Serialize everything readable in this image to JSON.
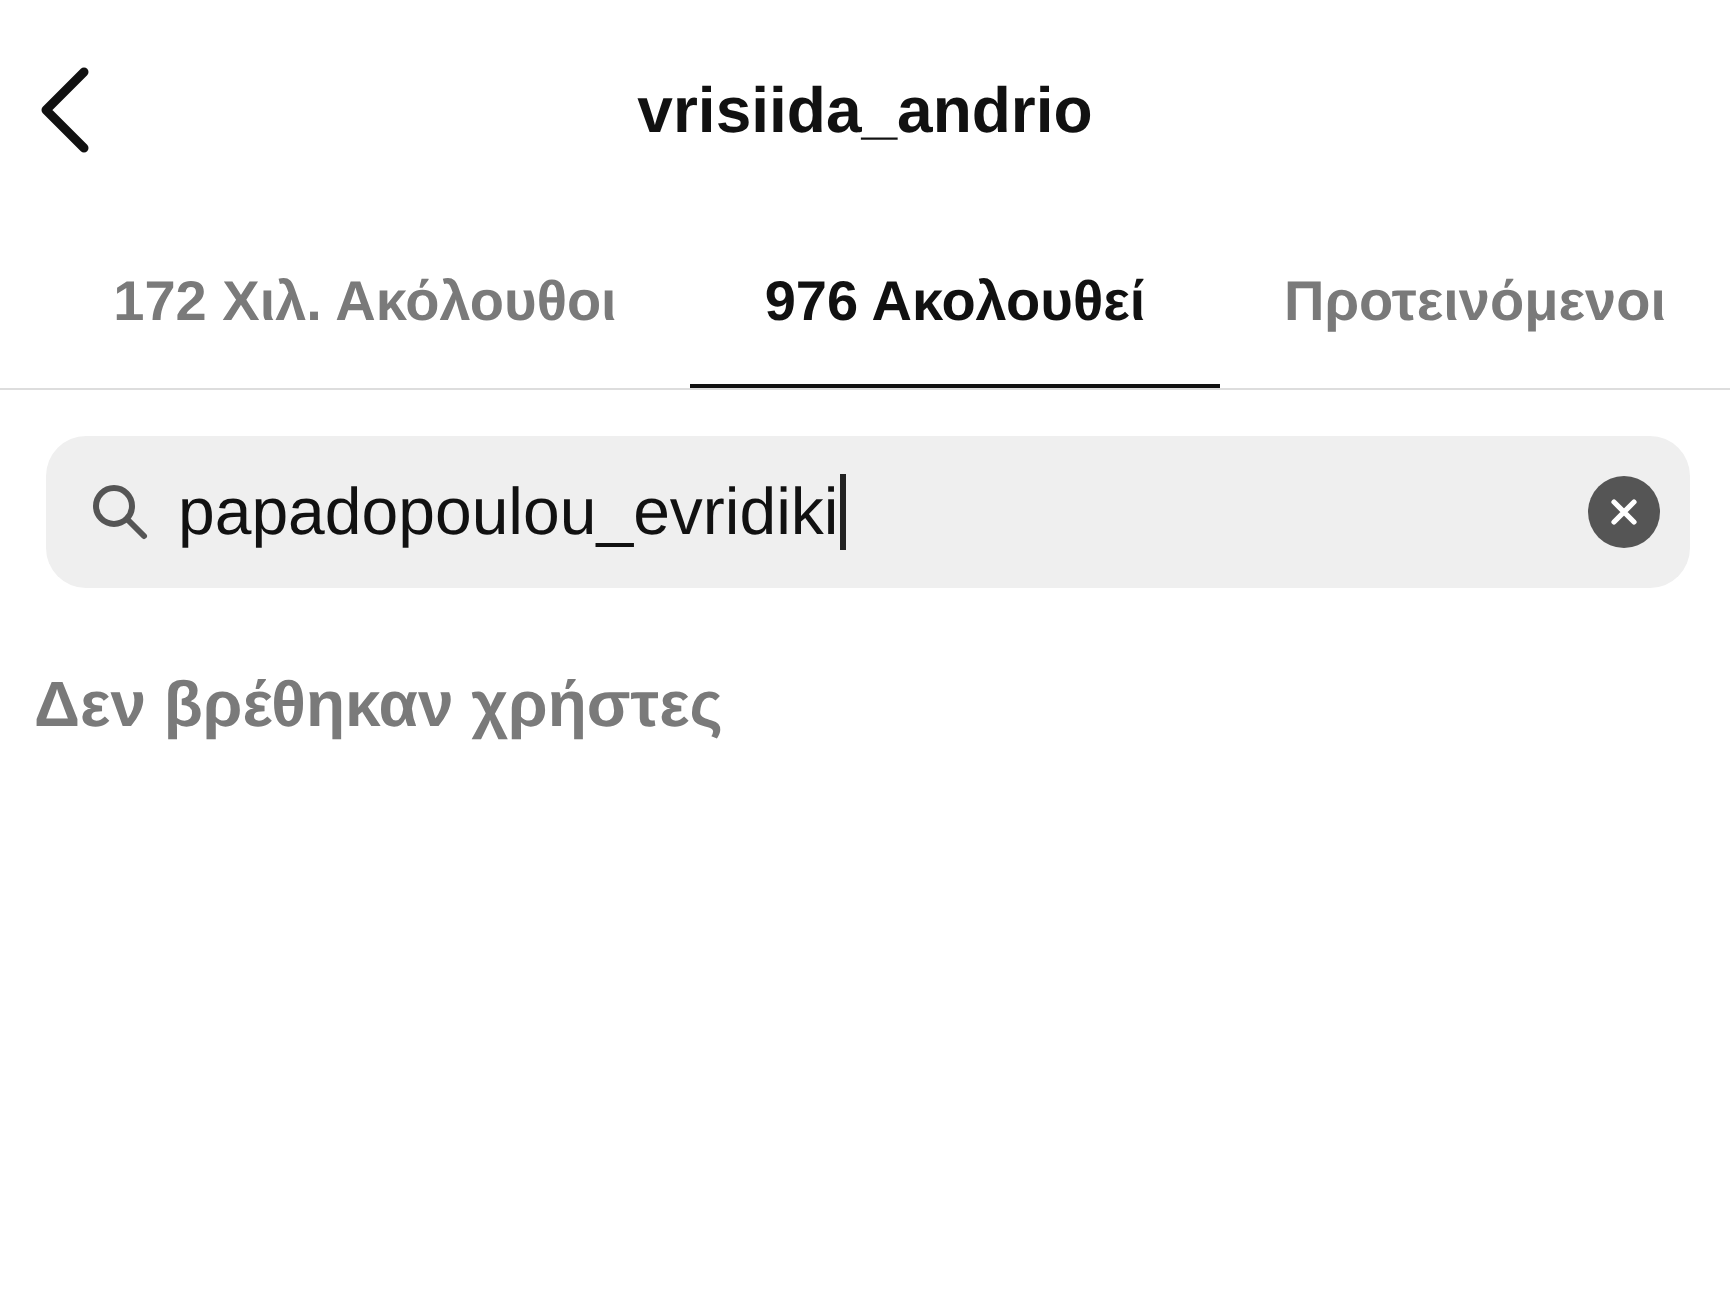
{
  "header": {
    "title": "vrisiida_andrio"
  },
  "tabs": [
    {
      "label": "172 Χιλ. Ακόλουθοι",
      "selected": false
    },
    {
      "label": "976 Ακολουθεί",
      "selected": true
    },
    {
      "label": "Προτεινόμενοι",
      "selected": false
    }
  ],
  "search": {
    "value": "papadopoulou_evridiki",
    "focused": true
  },
  "empty_message": "Δεν βρέθηκαν χρήστες"
}
